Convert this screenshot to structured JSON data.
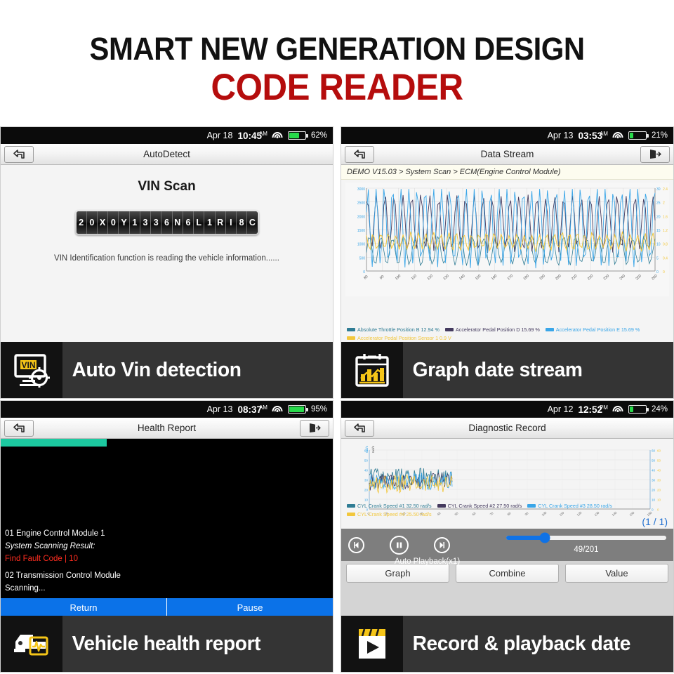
{
  "header": {
    "line1": "SMART NEW GENERATION DESIGN",
    "line2": "CODE READER",
    "line1_color": "#111111",
    "line2_color": "#b50d0d"
  },
  "panels": [
    {
      "id": "auto-vin",
      "statusbar": {
        "date": "Apr 18",
        "time": "10:45",
        "ampm": "AM",
        "battery_pct": "62%",
        "battery_level": 62,
        "wifi": "wifi-icon"
      },
      "titlebar": {
        "title": "AutoDetect",
        "back_icon": "back-arrow-icon",
        "exit_icon": null
      },
      "screen": {
        "heading": "VIN Scan",
        "vin_characters": [
          "2",
          "0",
          "X",
          "0",
          "Y",
          "1",
          "3",
          "3",
          "6",
          "N",
          "6",
          "L",
          "1",
          "R",
          "I",
          "8",
          "C"
        ],
        "note": "VIN Identification function is reading the vehicle information......"
      },
      "caption": {
        "label": "Auto Vin detection",
        "icon": "vin-monitor-icon",
        "icon_text": "VIN"
      }
    },
    {
      "id": "data-stream",
      "statusbar": {
        "date": "Apr 13",
        "time": "03:53",
        "ampm": "AM",
        "battery_pct": "21%",
        "battery_level": 21,
        "wifi": "wifi-icon"
      },
      "titlebar": {
        "title": "Data Stream",
        "back_icon": "back-arrow-icon",
        "exit_icon": "exit-icon"
      },
      "breadcrumb": "DEMO V15.03 > System Scan > ECM(Engine Control Module)",
      "caption": {
        "label": "Graph date stream",
        "icon": "calendar-chart-icon"
      }
    },
    {
      "id": "health-report",
      "statusbar": {
        "date": "Apr 13",
        "time": "08:37",
        "ampm": "AM",
        "battery_pct": "95%",
        "battery_level": 95,
        "wifi": "wifi-icon"
      },
      "titlebar": {
        "title": "Health Report",
        "back_icon": "back-arrow-icon",
        "exit_icon": "exit-icon"
      },
      "screen": {
        "progress_pct": 32,
        "lines": [
          {
            "text": "01 Engine Control Module 1",
            "style": "normal"
          },
          {
            "text": "System Scanning Result:",
            "style": "italic"
          },
          {
            "text": "Find Fault Code | 10",
            "style": "red"
          },
          {
            "text": "02 Transmission Control Module",
            "style": "normal"
          },
          {
            "text": "Scanning...",
            "style": "normal"
          }
        ],
        "buttons": [
          "Return",
          "Pause"
        ]
      },
      "caption": {
        "label": "Vehicle health report",
        "icon": "car-health-icon"
      }
    },
    {
      "id": "diagnostic-record",
      "statusbar": {
        "date": "Apr 12",
        "time": "12:52",
        "ampm": "PM",
        "battery_pct": "24%",
        "battery_level": 24,
        "wifi": "wifi-icon"
      },
      "titlebar": {
        "title": "Diagnostic Record",
        "back_icon": "back-arrow-icon",
        "exit_icon": null
      },
      "screen": {
        "page_indicator": "(1 / 1)",
        "player": {
          "prev_icon": "step-back-icon",
          "pause_icon": "pause-icon",
          "next_icon": "step-forward-icon",
          "mode_label": "Auto Playback(x1)",
          "frame_counter": "49/201",
          "progress_pct": 24
        },
        "buttons": [
          "Graph",
          "Combine",
          "Value"
        ]
      },
      "caption": {
        "label": "Record & playback date",
        "icon": "clapperboard-play-icon"
      }
    }
  ],
  "chart_data": [
    {
      "id": "data-stream-chart",
      "type": "line",
      "title": "",
      "xlabel": "",
      "ylabel": "",
      "grid": true,
      "legend_position": "bottom",
      "xlim": [
        80,
        260
      ],
      "xticks": [
        80,
        90,
        100,
        110,
        120,
        130,
        140,
        150,
        160,
        170,
        180,
        190,
        200,
        210,
        220,
        230,
        240,
        250,
        260
      ],
      "y_left_label": "",
      "y_left_ticks": [
        "3000",
        "2500",
        "2000",
        "1500",
        "1000",
        "500",
        "0"
      ],
      "ylim": [
        0,
        3000
      ],
      "y_right_ticks": [
        "30",
        "25",
        "20",
        "15",
        "10",
        "5",
        "0"
      ],
      "y_right2_ticks": [
        "2.4",
        "2",
        "1.6",
        "1.2",
        "0.8",
        "0.4",
        "0"
      ],
      "series": [
        {
          "name": "Absolute Throttle Position B 12.94 %",
          "color": "#2f7c94",
          "value": "12.94",
          "unit": "%"
        },
        {
          "name": "Accelerator Pedal Position D 15.69 %",
          "color": "#443a5e",
          "value": "15.69",
          "unit": "%"
        },
        {
          "name": "Accelerator Pedal Position E 15.69 %",
          "color": "#3aa6e8",
          "value": "15.69",
          "unit": "%"
        },
        {
          "name": "Accelerator Pedal Position Sensor 1 0.9 V",
          "color": "#f2c73c",
          "value": "0.9",
          "unit": "V"
        }
      ]
    },
    {
      "id": "diagnostic-record-chart",
      "type": "line",
      "title": "",
      "xlabel": "",
      "ylabel": "rad/s",
      "grid": true,
      "legend_position": "bottom",
      "xlim": [
        0,
        160
      ],
      "xticks": [
        0,
        10,
        20,
        30,
        40,
        50,
        60,
        70,
        80,
        90,
        100,
        110,
        120,
        130,
        140,
        150,
        160
      ],
      "ylim": [
        0,
        60
      ],
      "y_left_ticks": [
        "60",
        "50",
        "40",
        "30",
        "20",
        "10",
        "0"
      ],
      "y_axis_unit_left": "rad/s",
      "y_right_ticks": [
        "60",
        "50",
        "40",
        "30",
        "20",
        "10",
        "0"
      ],
      "series": [
        {
          "name": "CYL Crank Speed #1 32.50 rad/s",
          "color": "#2f7c94",
          "value": "32.50",
          "unit": "rad/s"
        },
        {
          "name": "CYL Crank Speed #2 27.50 rad/s",
          "color": "#443a5e",
          "value": "27.50",
          "unit": "rad/s"
        },
        {
          "name": "CYL Crank Speed #3 28.50 rad/s",
          "color": "#3aa6e8",
          "value": "28.50",
          "unit": "rad/s"
        },
        {
          "name": "CYL Crank Speed #4 25.50 rad/s",
          "color": "#f2c73c",
          "value": "25.50",
          "unit": "rad/s"
        }
      ]
    }
  ]
}
